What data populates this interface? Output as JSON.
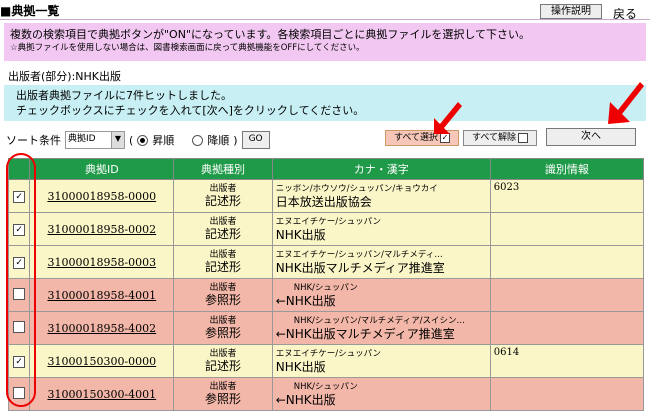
{
  "header": {
    "title": "■典拠一覧",
    "help_button": "操作説明",
    "back_link": "戻る"
  },
  "notice_pink": {
    "line1": "複数の検索項目で典拠ボタンが\"ON\"になっています。各検索項目ごとに典拠ファイルを選択して下さい。",
    "line2": "☆典拠ファイルを使用しない場合は、図書検索画面に戻って典拠機能をOFFにしてください。"
  },
  "publisher_label": "出版者(部分):NHK出版",
  "notice_cyan": {
    "line1": "出版者典拠ファイルに7件ヒットしました。",
    "line2": "チェックボックスにチェックを入れて[次へ]をクリックしてください。"
  },
  "sort": {
    "label": "ソート条件",
    "selected": "典拠ID",
    "paren_open": "(",
    "asc": "昇順",
    "desc": "降順",
    "paren_close": ")",
    "go_button": "GO",
    "asc_selected": true
  },
  "buttons": {
    "select_all": "すべて選択",
    "deselect_all": "すべて解除",
    "next": "次へ"
  },
  "table": {
    "headers": [
      "典拠ID",
      "典拠種別",
      "カナ・漢字",
      "識別情報"
    ],
    "rows": [
      {
        "checked": true,
        "id": "31000018958-0000",
        "type1": "出版者",
        "type2": "記述形",
        "kana": "ニッポン/ホウソウ/シュッパン/キョウカイ",
        "kanji": "日本放送出版協会",
        "info": "6023",
        "style": "yel"
      },
      {
        "checked": true,
        "id": "31000018958-0002",
        "type1": "出版者",
        "type2": "記述形",
        "kana": "エヌエイチケー/シュッパン",
        "kanji": "NHK出版",
        "info": "",
        "style": "yel"
      },
      {
        "checked": true,
        "id": "31000018958-0003",
        "type1": "出版者",
        "type2": "記述形",
        "kana": "エヌエイチケー/シュッパン/マルチメディ…",
        "kanji": "NHK出版マルチメディア推進室",
        "info": "",
        "style": "yel"
      },
      {
        "checked": false,
        "id": "31000018958-4001",
        "type1": "出版者",
        "type2": "参照形",
        "kana": "NHK/シュッパン",
        "kanji": "←NHK出版",
        "info": "",
        "style": "sal"
      },
      {
        "checked": false,
        "id": "31000018958-4002",
        "type1": "出版者",
        "type2": "参照形",
        "kana": "NHK/シュッパン/マルチメディア/スイシン…",
        "kanji": "←NHK出版マルチメディア推進室",
        "info": "",
        "style": "sal"
      },
      {
        "checked": true,
        "id": "31000150300-0000",
        "type1": "出版者",
        "type2": "記述形",
        "kana": "エヌエイチケー/シュッパン",
        "kanji": "NHK出版",
        "info": "0614",
        "style": "yel"
      },
      {
        "checked": false,
        "id": "31000150300-4001",
        "type1": "出版者",
        "type2": "参照形",
        "kana": "NHK/シュッパン",
        "kanji": "←NHK出版",
        "info": "",
        "style": "sal"
      }
    ]
  },
  "colors": {
    "header_green": "#1f9a49",
    "row_yellow": "#fbf6c8",
    "row_salmon": "#f2b7a8",
    "annotation_red": "#ee0000"
  }
}
